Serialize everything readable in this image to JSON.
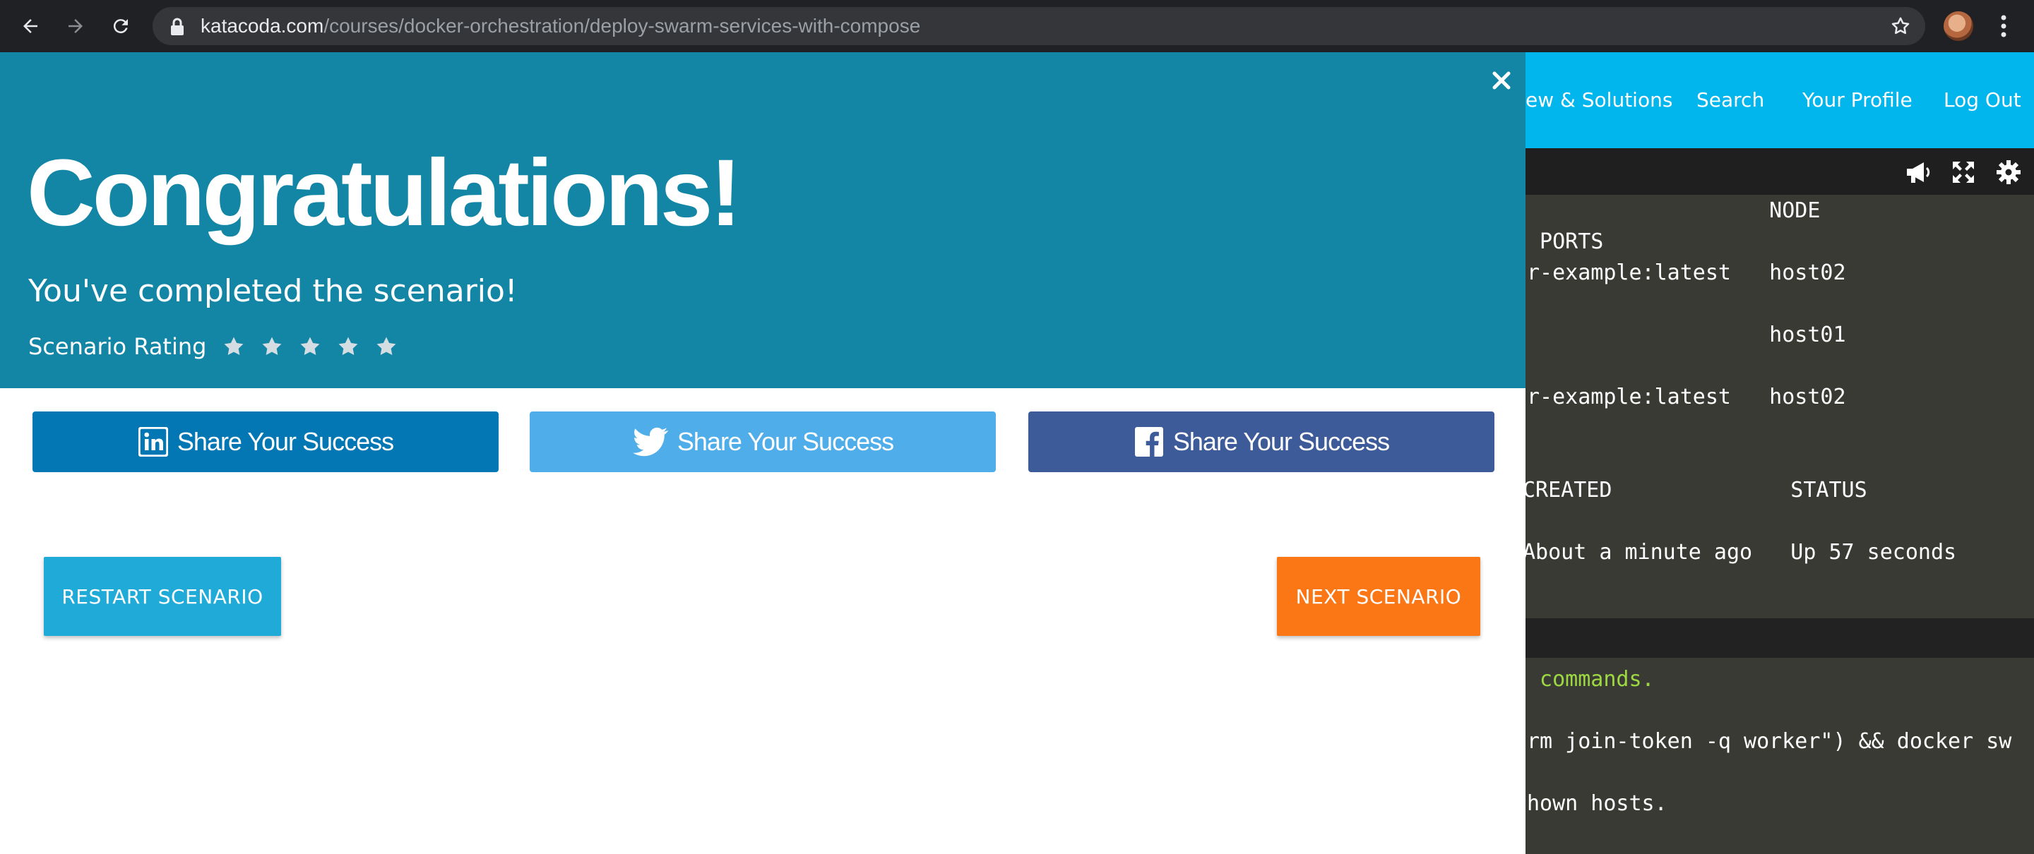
{
  "browser": {
    "url_host": "katacoda.com",
    "url_path": "/courses/docker-orchestration/deploy-swarm-services-with-compose",
    "icons": [
      "back-arrow-icon",
      "forward-arrow-icon",
      "reload-icon",
      "lock-icon",
      "bookmark-star-icon",
      "avatar",
      "kebab-menu-icon"
    ]
  },
  "site_nav": {
    "items": [
      {
        "label": "ew & Solutions"
      },
      {
        "label": "Search"
      },
      {
        "label": "Your Profile"
      },
      {
        "label": "Log Out"
      }
    ],
    "color": "#01b5ed"
  },
  "terminal": {
    "toolbar_icons": [
      "megaphone-icon",
      "expand-icon",
      "gear-icon"
    ],
    "upper_lines": [
      "                   NODE",
      " PORTS",
      "r-example:latest   host02",
      "",
      "                   host01",
      "",
      "r-example:latest   host02",
      "",
      "",
      "CREATED              STATUS",
      "",
      "About a minute ago   Up 57 seconds"
    ],
    "lower_lines": [
      " commands.",
      "",
      "rm join-token -q worker\") && docker sw",
      "",
      "hown hosts."
    ]
  },
  "modal": {
    "header_color": "#1386a6",
    "title": "Congratulations!",
    "subtitle": "You've completed the scenario!",
    "rating_label": "Scenario Rating",
    "rating_stars": 5,
    "share": {
      "linkedin": {
        "label": "Share Your Success",
        "color": "#0277b4"
      },
      "twitter": {
        "label": "Share Your Success",
        "color": "#4fade9"
      },
      "facebook": {
        "label": "Share Your Success",
        "color": "#3c5b98"
      }
    },
    "restart_label": "RESTART SCENARIO",
    "next_label": "NEXT SCENARIO",
    "restart_color": "#20aad7",
    "next_color": "#fb7716"
  }
}
